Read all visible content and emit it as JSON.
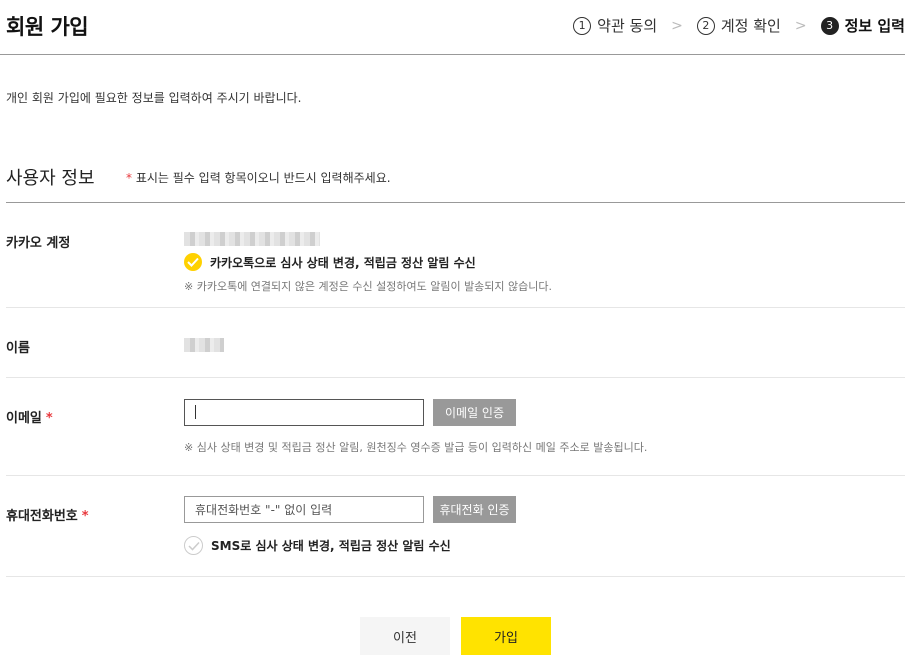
{
  "header": {
    "title": "회원 가입",
    "steps": [
      {
        "num": "1",
        "label": "약관 동의"
      },
      {
        "num": "2",
        "label": "계정 확인"
      },
      {
        "num": "3",
        "label": "정보 입력"
      }
    ],
    "separator": ">"
  },
  "intro": "개인 회원 가입에 필요한 정보를 입력하여 주시기 바랍니다.",
  "section": {
    "title": "사용자 정보",
    "required_star": "*",
    "required_note": "표시는 필수 입력 항목이오니 반드시 입력해주세요."
  },
  "kakao": {
    "label": "카카오 계정",
    "consent_label": "카카오톡으로 심사 상태 변경, 적립금 정산 알림 수신",
    "consent_checked": true,
    "note": "※ 카카오톡에 연결되지 않은 계정은 수신 설정하여도 알림이 발송되지 않습니다."
  },
  "name": {
    "label": "이름"
  },
  "email": {
    "label": "이메일",
    "required_star": "*",
    "value": "",
    "verify_button": "이메일 인증",
    "note": "※ 심사 상태 변경 및 적립금 정산 알림, 원천징수 영수증 발급 등이 입력하신 메일 주소로 발송됩니다."
  },
  "phone": {
    "label": "휴대전화번호",
    "required_star": "*",
    "placeholder": "휴대전화번호 \"-\" 없이 입력",
    "verify_button": "휴대전화 인증",
    "sms_label": "SMS로 심사 상태 변경, 적립금 정산 알림 수신",
    "sms_checked": false
  },
  "buttons": {
    "prev": "이전",
    "join": "가입"
  },
  "colors": {
    "accent": "#ffe300",
    "check_on": "#ffd100",
    "required": "#e8383d",
    "gray_button": "#999999"
  }
}
